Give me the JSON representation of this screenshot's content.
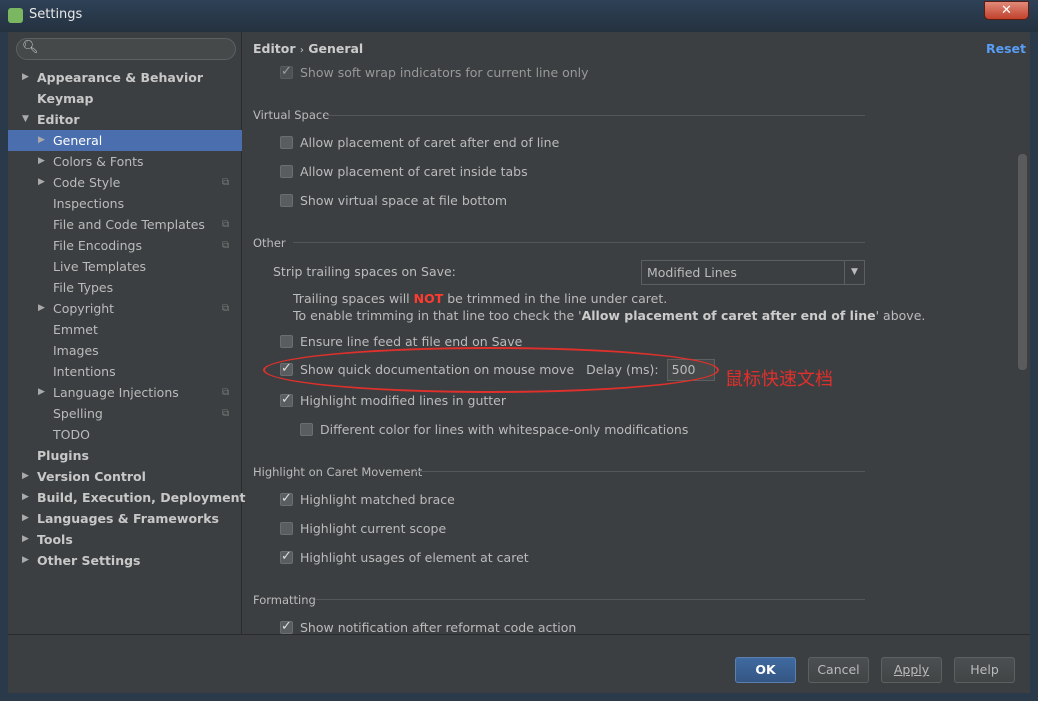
{
  "window": {
    "title": "Settings",
    "close": "✕"
  },
  "sidebar": {
    "items": [
      {
        "label": "Appearance & Behavior",
        "arrow": "▶"
      },
      {
        "label": "Keymap",
        "arrow": ""
      },
      {
        "label": "Editor",
        "arrow": "▼"
      },
      {
        "label": "General",
        "arrow": "▶"
      },
      {
        "label": "Colors & Fonts",
        "arrow": "▶"
      },
      {
        "label": "Code Style",
        "arrow": "▶"
      },
      {
        "label": "Inspections",
        "arrow": ""
      },
      {
        "label": "File and Code Templates",
        "arrow": ""
      },
      {
        "label": "File Encodings",
        "arrow": ""
      },
      {
        "label": "Live Templates",
        "arrow": ""
      },
      {
        "label": "File Types",
        "arrow": ""
      },
      {
        "label": "Copyright",
        "arrow": "▶"
      },
      {
        "label": "Emmet",
        "arrow": ""
      },
      {
        "label": "Images",
        "arrow": ""
      },
      {
        "label": "Intentions",
        "arrow": ""
      },
      {
        "label": "Language Injections",
        "arrow": "▶"
      },
      {
        "label": "Spelling",
        "arrow": ""
      },
      {
        "label": "TODO",
        "arrow": ""
      },
      {
        "label": "Plugins",
        "arrow": ""
      },
      {
        "label": "Version Control",
        "arrow": "▶"
      },
      {
        "label": "Build, Execution, Deployment",
        "arrow": "▶"
      },
      {
        "label": "Languages & Frameworks",
        "arrow": "▶"
      },
      {
        "label": "Tools",
        "arrow": "▶"
      },
      {
        "label": "Other Settings",
        "arrow": "▶"
      }
    ]
  },
  "breadcrumb": {
    "parent": "Editor",
    "sep": "›",
    "current": "General"
  },
  "reset": "Reset",
  "options": {
    "soft_wrap": "Show soft wrap indicators for current line only",
    "vs_title": "Virtual Space",
    "vs1": "Allow placement of caret after end of line",
    "vs2": "Allow placement of caret inside tabs",
    "vs3": "Show virtual space at file bottom",
    "other_title": "Other",
    "strip_label": "Strip trailing spaces on Save:",
    "strip_value": "Modified Lines",
    "hint1a": "Trailing spaces will ",
    "hint1b": "NOT",
    "hint1c": " be trimmed in the line under caret.",
    "hint2a": "To enable trimming in that line too check the '",
    "hint2b": "Allow placement of caret after end of line",
    "hint2c": "' above.",
    "line_feed": "Ensure line feed at file end on Save",
    "quick_doc": "Show quick documentation on mouse move",
    "delay_label": "Delay (ms):",
    "delay_value": "500",
    "highlight_mod": "Highlight modified lines in gutter",
    "diff_color": "Different color for lines with whitespace-only modifications",
    "caret_title": "Highlight on Caret Movement",
    "brace": "Highlight matched brace",
    "scope": "Highlight current scope",
    "usages": "Highlight usages of element at caret",
    "fmt_title": "Formatting",
    "notif": "Show notification after reformat code action"
  },
  "annotation": "鼠标快速文档",
  "buttons": {
    "ok": "OK",
    "cancel": "Cancel",
    "apply": "Apply",
    "help": "Help"
  }
}
